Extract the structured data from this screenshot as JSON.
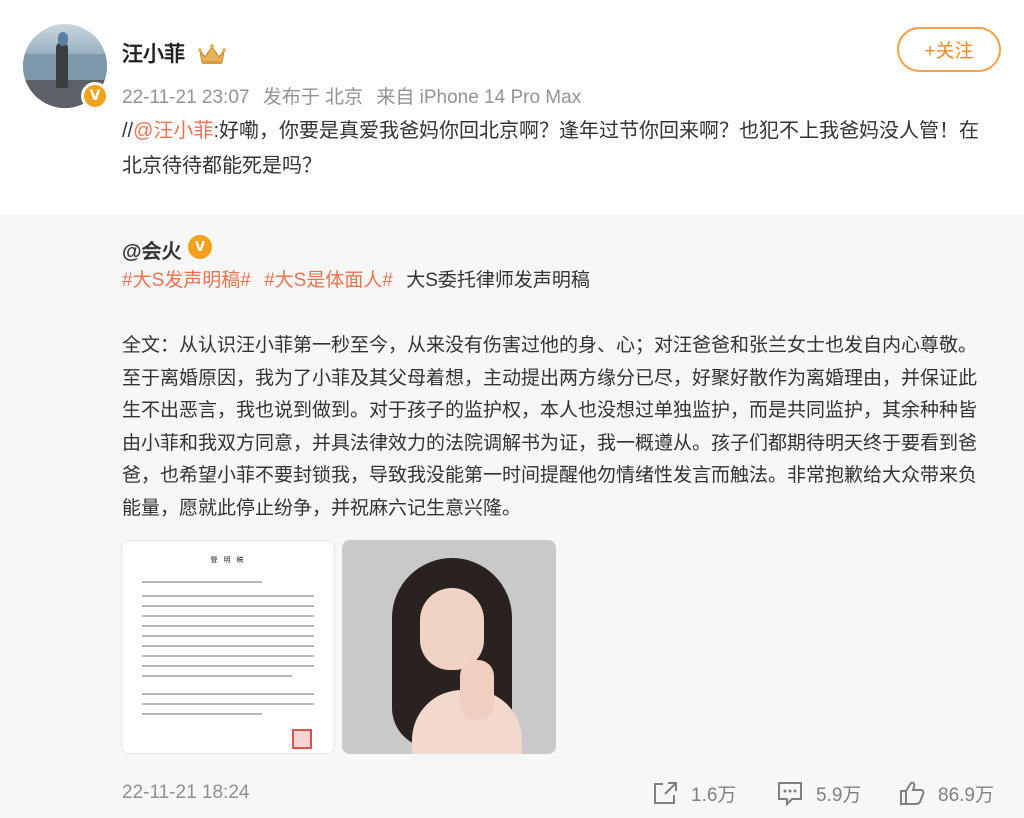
{
  "post": {
    "username": "汪小菲",
    "meta": {
      "time": "22-11-21 23:07",
      "location": "发布于 北京",
      "source": "来自 iPhone 14 Pro Max"
    },
    "follow_label": "+关注",
    "repost_prefix": "//",
    "repost_mention": "@汪小菲",
    "repost_body": ":好嘞，你要是真爱我爸妈你回北京啊？逢年过节你回来啊？也犯不上我爸妈没人管！在北京待待都能死是吗？"
  },
  "original": {
    "author": "@会火",
    "tags": [
      "#大S发声明稿#",
      "#大S是体面人#"
    ],
    "tag_suffix": "大S委托律师发声明稿",
    "full_text": "全文：从认识汪小菲第一秒至今，从来没有伤害过他的身、心；对汪爸爸和张兰女士也发自内心尊敬。至于离婚原因，我为了小菲及其父母着想，主动提出两方缘分已尽，好聚好散作为离婚理由，并保证此生不出恶言，我也说到做到。对于孩子的监护权，本人也没想过单独监护，而是共同监护，其余种种皆由小菲和我双方同意，并具法律效力的法院调解书为证，我一概遵从。孩子们都期待明天终于要看到爸爸，也希望小菲不要封锁我，导致我没能第一时间提醒他勿情绪性发言而触法。非常抱歉给大众带来负能量，愿就此停止纷争，并祝麻六记生意兴隆。",
    "doc_title": "聲 明 稿",
    "timestamp": "22-11-21 18:24"
  },
  "actions": {
    "share_count": "1.6万",
    "comment_count": "5.9万",
    "like_count": "86.9万"
  },
  "colors": {
    "accent": "#eb7350",
    "follow": "#f28a22",
    "verified": "#f4a11e",
    "muted": "#939393"
  },
  "icons": [
    "verified-badge-icon",
    "crown-icon",
    "share-icon",
    "comment-icon",
    "like-icon"
  ]
}
